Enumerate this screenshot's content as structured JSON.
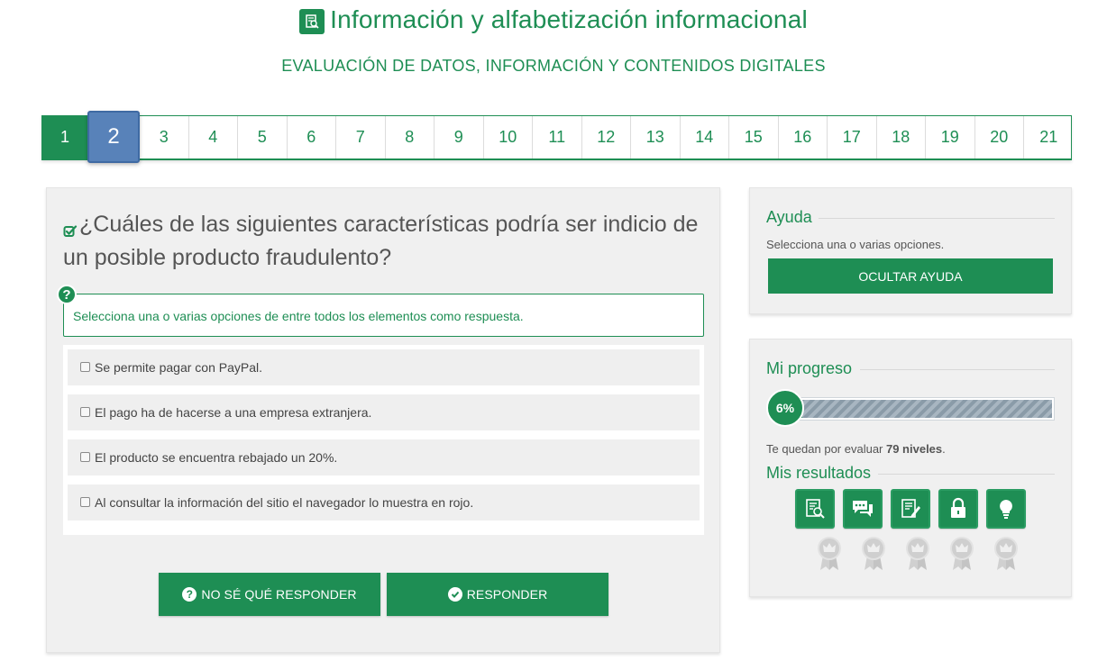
{
  "header": {
    "title": "Información y alfabetización informacional",
    "title_icon": "document-search-icon",
    "subtitle": "EVALUACIÓN DE DATOS, INFORMACIÓN Y CONTENIDOS DIGITALES"
  },
  "stepper": {
    "steps": [
      "1",
      "2",
      "3",
      "4",
      "5",
      "6",
      "7",
      "8",
      "9",
      "10",
      "11",
      "12",
      "13",
      "14",
      "15",
      "16",
      "17",
      "18",
      "19",
      "20",
      "21"
    ],
    "completed": [
      "1"
    ],
    "current": "2"
  },
  "question": {
    "text": "¿Cuáles de las siguientes características podría ser indicio de un posible producto fraudulento?",
    "hint": "Selecciona una o varias opciones de entre todos los elementos como respuesta.",
    "options": [
      {
        "label": "Se permite pagar con PayPal.",
        "checked": false
      },
      {
        "label": "El pago ha de hacerse a una empresa extranjera.",
        "checked": false
      },
      {
        "label": "El producto se encuentra rebajado un 20%.",
        "checked": false
      },
      {
        "label": "Al consultar la información del sitio el navegador lo muestra en rojo.",
        "checked": false
      }
    ]
  },
  "actions": {
    "dont_know_label": "NO SÉ QUÉ RESPONDER",
    "answer_label": "RESPONDER"
  },
  "help": {
    "heading": "Ayuda",
    "description": "Selecciona una o varias opciones.",
    "hide_label": "OCULTAR AYUDA"
  },
  "progress": {
    "heading": "Mi progreso",
    "percent_label": "6%",
    "percent_value": 6,
    "remaining_prefix": "Te quedan por evaluar ",
    "remaining_count": "79 niveles",
    "remaining_suffix": ".",
    "results_heading": "Mis resultados",
    "result_icons": [
      "document-search-icon",
      "chat-icon",
      "edit-document-icon",
      "lock-icon",
      "lightbulb-icon"
    ],
    "medals": [
      "medal-icon",
      "medal-icon",
      "medal-icon",
      "medal-icon",
      "medal-icon"
    ]
  },
  "colors": {
    "accent": "#1e8e54",
    "current_step": "#5882b9",
    "panel": "#f0f0f0"
  }
}
